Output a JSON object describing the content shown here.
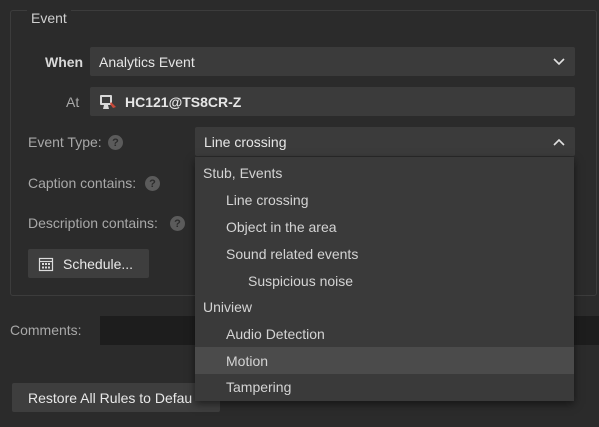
{
  "event_group": {
    "legend": "Event",
    "when_label": "When",
    "when_value": "Analytics Event",
    "at_label": "At",
    "at_value": "HC121@TS8CR-Z",
    "event_type_label": "Event Type:",
    "event_type_value": "Line crossing",
    "caption_label": "Caption contains:",
    "description_label": "Description contains:",
    "help_glyph": "?",
    "schedule_label": "Schedule..."
  },
  "dropdown": {
    "options": [
      {
        "label": "Stub, Events",
        "level": 0,
        "selected": false
      },
      {
        "label": "Line crossing",
        "level": 1,
        "selected": false
      },
      {
        "label": "Object in the area",
        "level": 1,
        "selected": false
      },
      {
        "label": "Sound related events",
        "level": 1,
        "selected": false
      },
      {
        "label": "Suspicious noise",
        "level": 2,
        "selected": false
      },
      {
        "label": "Uniview",
        "level": 0,
        "selected": false
      },
      {
        "label": "Audio Detection",
        "level": 1,
        "selected": false
      },
      {
        "label": "Motion",
        "level": 1,
        "selected": true
      },
      {
        "label": "Tampering",
        "level": 1,
        "selected": false
      }
    ]
  },
  "comments_label": "Comments:",
  "restore_button_label": "Restore All Rules to Defau",
  "icons": {
    "camera": "camera-icon",
    "calendar": "calendar-icon",
    "chevron_down": "chevron-down-icon",
    "chevron_up": "chevron-up-icon"
  }
}
